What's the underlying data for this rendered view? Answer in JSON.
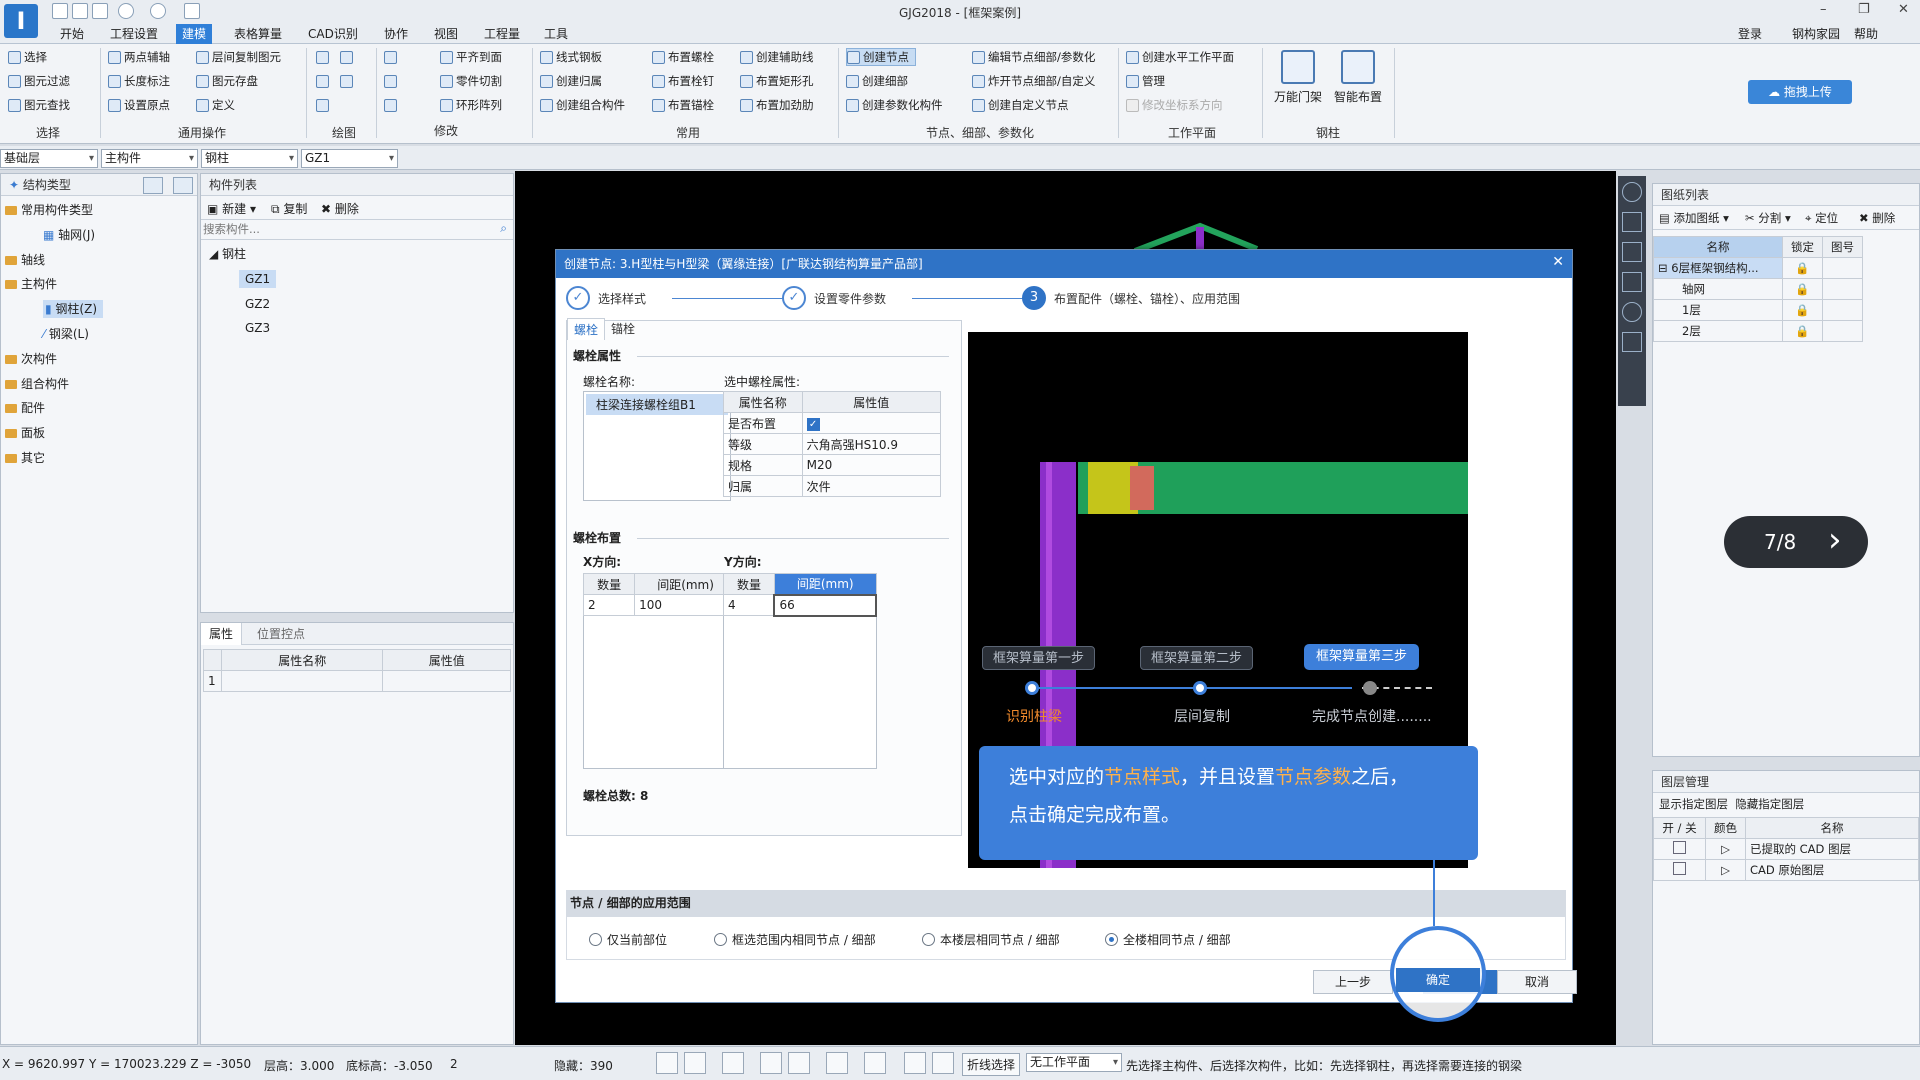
{
  "window": {
    "title": "GJG2018 - [框架案例]",
    "logo": "I",
    "min": "–",
    "restore": "❐",
    "close": "✕"
  },
  "menu": {
    "tabs": [
      "开始",
      "工程设置",
      "建模",
      "表格算量",
      "CAD识别",
      "协作",
      "视图",
      "工程量",
      "工具"
    ],
    "active": "建模",
    "right": {
      "login": "登录",
      "home": "钢构家园",
      "help": "帮助"
    }
  },
  "ribbon": {
    "select": {
      "items": [
        "选择",
        "图元过滤",
        "图元查找"
      ],
      "group": "选择"
    },
    "common_ops": {
      "items": [
        "两点辅轴",
        "长度标注",
        "设置原点",
        "层间复制图元",
        "图元存盘",
        "定义"
      ],
      "group": "通用操作"
    },
    "draw": {
      "group": "绘图"
    },
    "modify": {
      "items": [
        "平齐到面",
        "零件切割",
        "环形阵列"
      ],
      "group": "修改"
    },
    "common": {
      "items": [
        "线式钢板",
        "创建归属",
        "创建组合构件",
        "布置螺栓",
        "布置栓钉",
        "布置锚栓",
        "创建辅助线",
        "布置矩形孔",
        "布置加劲肋"
      ],
      "group": "常用"
    },
    "node": {
      "items": [
        "创建节点",
        "创建细部",
        "创建参数化构件",
        "编辑节点细部/参数化",
        "炸开节点细部/自定义",
        "创建自定义节点"
      ],
      "group": "节点、细部、参数化"
    },
    "workplane": {
      "items": [
        "创建水平工作平面",
        "管理",
        "修改坐标系方向"
      ],
      "group": "工作平面"
    },
    "steel": {
      "items": [
        "万能门架",
        "智能布置"
      ],
      "group": "钢柱"
    },
    "upload": "拖拽上传"
  },
  "selectors": [
    "基础层",
    "主构件",
    "钢柱",
    "GZ1"
  ],
  "left_panel": {
    "title": "结构类型",
    "tree": [
      {
        "label": "常用构件类型",
        "level": 0
      },
      {
        "label": "轴网(J)",
        "level": 2
      },
      {
        "label": "轴线",
        "level": 0
      },
      {
        "label": "主构件",
        "level": 0
      },
      {
        "label": "钢柱(Z)",
        "level": 2,
        "selected": true
      },
      {
        "label": "钢梁(L)",
        "level": 2
      },
      {
        "label": "次构件",
        "level": 0
      },
      {
        "label": "组合构件",
        "level": 0
      },
      {
        "label": "配件",
        "level": 0
      },
      {
        "label": "面板",
        "level": 0
      },
      {
        "label": "其它",
        "level": 0
      }
    ]
  },
  "component_list": {
    "title": "构件列表",
    "toolbar": [
      "新建",
      "复制",
      "删除"
    ],
    "search_placeholder": "搜索构件...",
    "group": "钢柱",
    "items": [
      "GZ1",
      "GZ2",
      "GZ3"
    ],
    "selected": "GZ1"
  },
  "property_panel": {
    "tabs": [
      "属性",
      "位置控点"
    ],
    "headers": [
      "属性名称",
      "属性值"
    ],
    "row_num": "1"
  },
  "drawing_list": {
    "title": "图纸列表",
    "toolbar": [
      "添加图纸",
      "分割",
      "定位",
      "删除"
    ],
    "headers": [
      "名称",
      "锁定",
      "图号"
    ],
    "rows": [
      "6层框架钢结构...",
      "轴网",
      "1层",
      "2层"
    ]
  },
  "layer_manager": {
    "title": "图层管理",
    "actions": [
      "显示指定图层",
      "隐藏指定图层"
    ],
    "headers": [
      "开 / 关",
      "颜色",
      "名称"
    ],
    "rows": [
      "已提取的 CAD 图层",
      "CAD 原始图层"
    ]
  },
  "dialog": {
    "title": "创建节点: 3.H型柱与H型梁（翼缘连接）[广联达钢结构算量产品部]",
    "close": "✕",
    "steps": [
      {
        "label": "选择样式",
        "mark": "✓"
      },
      {
        "label": "设置零件参数",
        "mark": "✓"
      },
      {
        "label": "布置配件（螺栓、锚栓）、应用范围",
        "mark": "3"
      }
    ],
    "tabs": [
      "螺栓",
      "锚栓"
    ],
    "bolt_props_title": "螺栓属性",
    "bolt_name_label": "螺栓名称:",
    "bolt_name": "柱梁连接螺栓组B1",
    "selected_props_label": "选中螺栓属性:",
    "prop_headers": [
      "属性名称",
      "属性值"
    ],
    "props": [
      {
        "name": "是否布置",
        "value": "✓"
      },
      {
        "name": "等级",
        "value": "六角高强HS10.9"
      },
      {
        "name": "规格",
        "value": "M20"
      },
      {
        "name": "归属",
        "value": "次件"
      }
    ],
    "layout_title": "螺栓布置",
    "x_label": "X方向:",
    "y_label": "Y方向:",
    "grid_headers": [
      "数量",
      "间距(mm)"
    ],
    "x_row": [
      "2",
      "100"
    ],
    "y_row": [
      "4",
      "66"
    ],
    "total": "螺栓总数:  8",
    "scope_title": "节点 / 细部的应用范围",
    "scope_options": [
      "仅当前部位",
      "框选范围内相同节点 / 细部",
      "本楼层相同节点 / 细部",
      "全楼相同节点 / 细部"
    ],
    "scope_selected": 3,
    "buttons": {
      "prev": "上一步",
      "ok": "确定",
      "cancel": "取消"
    }
  },
  "tutorial": {
    "steps": [
      "框架算量第一步",
      "框架算量第二步",
      "框架算量第三步"
    ],
    "step_labels": [
      "识别柱梁",
      "层间复制",
      "完成节点创建........"
    ],
    "tip_line1_a": "选中对应的",
    "tip_line1_b": "节点样式",
    "tip_line1_c": "，并且设置",
    "tip_line1_d": "节点参数",
    "tip_line1_e": "之后，",
    "tip_line2": "点击确定完成布置。",
    "pager": "7/8",
    "pager_next": "›"
  },
  "statusbar": {
    "coords": "X = 9620.997 Y = 170023.229 Z = -3050",
    "floor_height": "层高：3.000",
    "base_height": "底标高：-3.050",
    "count": "2",
    "hidden": "隐藏：390",
    "polyline": "折线选择",
    "workplane": "无工作平面",
    "hint": "先选择主构件、后选择次构件，比如：先选择钢柱，再选择需要连接的钢梁"
  },
  "colors": {
    "accent": "#2f73c6",
    "highlight": "#ffb14a",
    "column": "#8b2fc9",
    "beam": "#1fa05a"
  }
}
